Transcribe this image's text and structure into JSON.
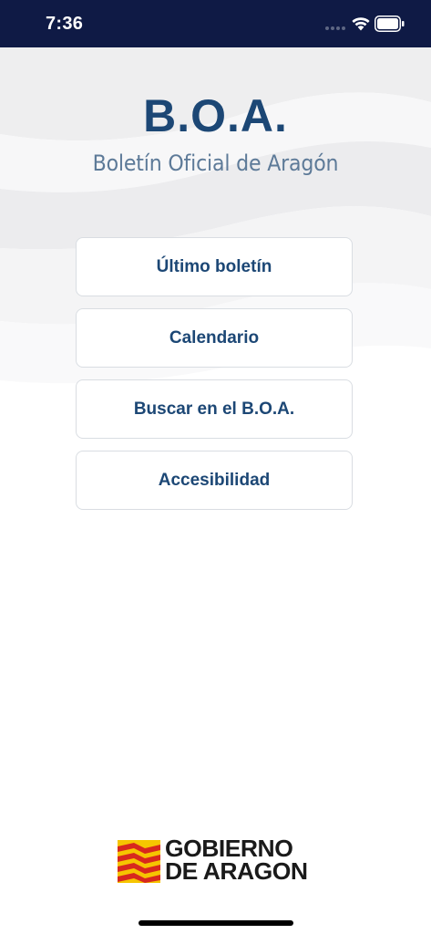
{
  "status_bar": {
    "time": "7:36",
    "wifi_icon": "wifi-icon",
    "battery_icon": "battery-icon",
    "background": "#0f1a45"
  },
  "header": {
    "title": "B.O.A.",
    "subtitle": "Boletín Oficial de Aragón"
  },
  "menu": {
    "items": [
      {
        "label": "Último boletín"
      },
      {
        "label": "Calendario"
      },
      {
        "label": "Buscar en el B.O.A."
      },
      {
        "label": "Accesibilidad"
      }
    ]
  },
  "footer": {
    "logo_line1": "GOBIERNO",
    "logo_line2": "DE ARAGON",
    "logo_icon": "aragon-flag-icon"
  },
  "colors": {
    "accent": "#1c4775",
    "subtitle": "#5d7a98",
    "button_border": "#d9dde2",
    "flag_yellow": "#f6c500",
    "flag_red": "#d7281e"
  }
}
